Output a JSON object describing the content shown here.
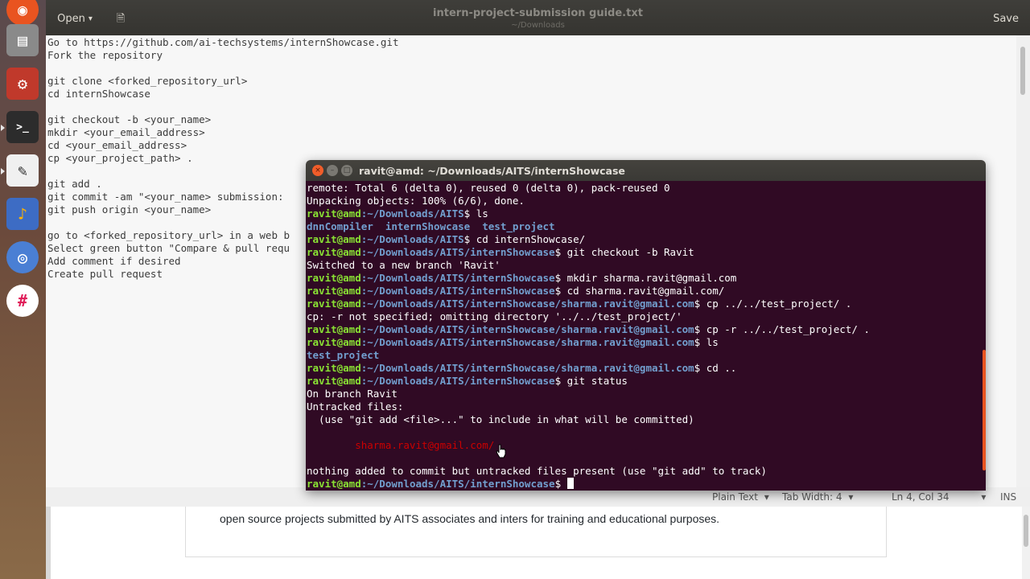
{
  "launcher": {
    "items": [
      {
        "name": "ubuntu-dash-icon",
        "symbol": "◉"
      },
      {
        "name": "files-icon",
        "symbol": "▤"
      },
      {
        "name": "settings-icon",
        "symbol": "⚙"
      },
      {
        "name": "terminal-icon",
        "symbol": ">_"
      },
      {
        "name": "text-editor-icon",
        "symbol": "✎"
      },
      {
        "name": "audacity-icon",
        "symbol": "♪"
      },
      {
        "name": "chromium-icon",
        "symbol": "◎"
      },
      {
        "name": "slack-icon",
        "symbol": "#"
      }
    ]
  },
  "editor": {
    "open_label": "Open",
    "open_arrow": "▾",
    "new_tab_symbol": "🗎",
    "title": "intern-project-submission guide.txt",
    "subtitle": "~/Downloads",
    "save_label": "Save",
    "lines": [
      "Go to https://github.com/ai-techsystems/internShowcase.git",
      "Fork the repository",
      "",
      "git clone <forked_repository_url>",
      "cd internShowcase",
      "",
      "git checkout -b <your_name>",
      "mkdir <your_email_address>",
      "cd <your_email_address>",
      "cp <your_project_path> .",
      "",
      "git add .",
      "git commit -am \"<your_name> submission:",
      "git push origin <your_name>",
      "",
      "go to <forked_repository_url> in a web b",
      "Select green button \"Compare & pull requ",
      "Add comment if desired",
      "Create pull request"
    ]
  },
  "statusbar": {
    "language": "Plain Text",
    "tab_width": "Tab Width: 4",
    "position": "Ln 4, Col 34",
    "mode": "INS",
    "arrow": "▾"
  },
  "browser": {
    "readme_text": "open source projects submitted by AITS associates and inters for training and educational purposes."
  },
  "terminal": {
    "title": "ravit@amd: ~/Downloads/AITS/internShowcase",
    "close_symbol": "×",
    "min_symbol": "–",
    "max_symbol": "□",
    "user": "ravit@amd",
    "lines": [
      {
        "text": "remote: Total 6 (delta 0), reused 0 (delta 0), pack-reused 0"
      },
      {
        "text": "Unpacking objects: 100% (6/6), done."
      },
      {
        "path": ":~/Downloads/AITS",
        "cmd": "$ ls"
      },
      {
        "dirs": "dnnCompiler  internShowcase  test_project"
      },
      {
        "path": ":~/Downloads/AITS",
        "cmd": "$ cd internShowcase/"
      },
      {
        "path": ":~/Downloads/AITS/internShowcase",
        "cmd": "$ git checkout -b Ravit"
      },
      {
        "text": "Switched to a new branch 'Ravit'"
      },
      {
        "path": ":~/Downloads/AITS/internShowcase",
        "cmd": "$ mkdir sharma.ravit@gmail.com"
      },
      {
        "path": ":~/Downloads/AITS/internShowcase",
        "cmd": "$ cd sharma.ravit@gmail.com/"
      },
      {
        "path": ":~/Downloads/AITS/internShowcase/sharma.ravit@gmail.com",
        "cmd": "$ cp ../../test_project/ ."
      },
      {
        "text": "cp: -r not specified; omitting directory '../../test_project/'"
      },
      {
        "path": ":~/Downloads/AITS/internShowcase/sharma.ravit@gmail.com",
        "cmd": "$ cp -r ../../test_project/ ."
      },
      {
        "path": ":~/Downloads/AITS/internShowcase/sharma.ravit@gmail.com",
        "cmd": "$ ls"
      },
      {
        "dirs": "test_project"
      },
      {
        "path": ":~/Downloads/AITS/internShowcase/sharma.ravit@gmail.com",
        "cmd": "$ cd .."
      },
      {
        "path": ":~/Downloads/AITS/internShowcase",
        "cmd": "$ git status"
      },
      {
        "text": "On branch Ravit"
      },
      {
        "text": "Untracked files:"
      },
      {
        "text": "  (use \"git add <file>...\" to include in what will be committed)"
      },
      {
        "text": ""
      },
      {
        "red": "        sharma.ravit@gmail.com/"
      },
      {
        "text": ""
      },
      {
        "text": "nothing added to commit but untracked files present (use \"git add\" to track)"
      },
      {
        "path": ":~/Downloads/AITS/internShowcase",
        "cmd": "$ ",
        "cursor": true
      }
    ]
  },
  "colors": {
    "terminal_bg": "#300a24",
    "prompt_user": "#8ae234",
    "prompt_path": "#729fcf",
    "untracked": "#cc0000",
    "scroll_accent": "#e95420"
  }
}
